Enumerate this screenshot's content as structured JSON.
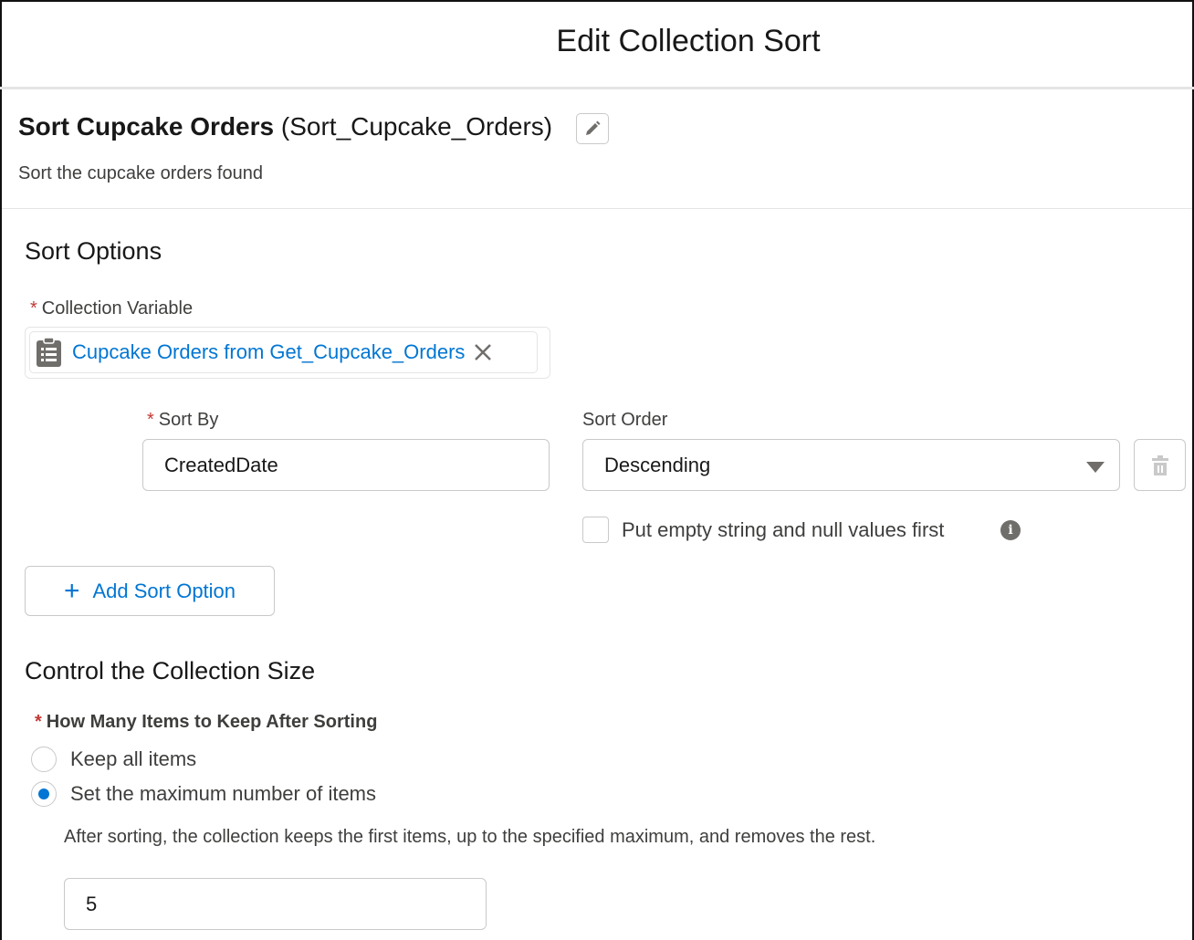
{
  "header": {
    "title": "Edit Collection Sort"
  },
  "element": {
    "label": "Sort Cupcake Orders",
    "api_name": "(Sort_Cupcake_Orders)",
    "description": "Sort the cupcake orders found"
  },
  "sort_options": {
    "heading": "Sort Options",
    "collection_variable_label": "Collection Variable",
    "collection_variable_value": "Cupcake Orders from Get_Cupcake_Orders",
    "sort_by_label": "Sort By",
    "sort_by_value": "CreatedDate",
    "sort_order_label": "Sort Order",
    "sort_order_value": "Descending",
    "nulls_first_label": "Put empty string and null values first",
    "nulls_first_checked": false,
    "add_option_label": "Add Sort Option"
  },
  "collection_size": {
    "heading": "Control the Collection Size",
    "question": "How Many Items to Keep After Sorting",
    "options": [
      {
        "label": "Keep all items",
        "selected": false
      },
      {
        "label": "Set the maximum number of items",
        "selected": true
      }
    ],
    "help": "After sorting, the collection keeps the first items, up to the specified maximum, and removes the rest.",
    "max_value": "5"
  },
  "colors": {
    "accent": "#0176d3",
    "required": "#c23934"
  }
}
